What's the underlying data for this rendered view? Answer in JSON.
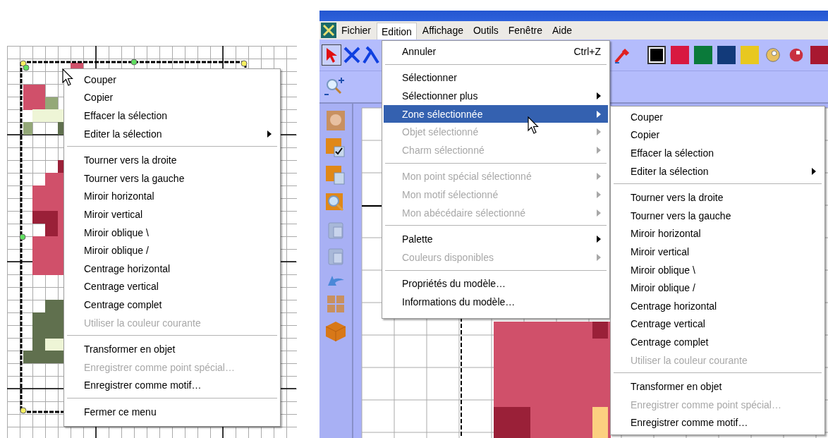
{
  "left_view": {
    "context_menu": {
      "groups": [
        [
          {
            "label": "Couper",
            "disabled": false,
            "submenu": false
          },
          {
            "label": "Copier",
            "disabled": false,
            "submenu": false
          },
          {
            "label": "Effacer la sélection",
            "disabled": false,
            "submenu": false
          },
          {
            "label": "Editer la sélection",
            "disabled": false,
            "submenu": true
          }
        ],
        [
          {
            "label": "Tourner vers la droite",
            "disabled": false,
            "submenu": false
          },
          {
            "label": "Tourner vers la gauche",
            "disabled": false,
            "submenu": false
          },
          {
            "label": "Miroir horizontal",
            "disabled": false,
            "submenu": false
          },
          {
            "label": "Miroir vertical",
            "disabled": false,
            "submenu": false
          },
          {
            "label": "Miroir oblique \\",
            "disabled": false,
            "submenu": false
          },
          {
            "label": "Miroir oblique /",
            "disabled": false,
            "submenu": false
          },
          {
            "label": "Centrage horizontal",
            "disabled": false,
            "submenu": false
          },
          {
            "label": "Centrage vertical",
            "disabled": false,
            "submenu": false
          },
          {
            "label": "Centrage complet",
            "disabled": false,
            "submenu": false
          },
          {
            "label": "Utiliser la couleur courante",
            "disabled": true,
            "submenu": false
          }
        ],
        [
          {
            "label": "Transformer en objet",
            "disabled": false,
            "submenu": false
          },
          {
            "label": "Enregistrer comme point spécial…",
            "disabled": true,
            "submenu": false
          },
          {
            "label": "Enregistrer comme motif…",
            "disabled": false,
            "submenu": false
          }
        ],
        [
          {
            "label": "Fermer ce menu",
            "disabled": false,
            "submenu": false
          }
        ]
      ]
    }
  },
  "right_view": {
    "menu_bar": [
      {
        "label": "Fichier",
        "selected": false
      },
      {
        "label": "Edition",
        "selected": true
      },
      {
        "label": "Affichage",
        "selected": false
      },
      {
        "label": "Outils",
        "selected": false
      },
      {
        "label": "Fenêtre",
        "selected": false
      },
      {
        "label": "Aide",
        "selected": false
      }
    ],
    "toolbar": {
      "swatches": [
        {
          "color": "#000000",
          "selected": true
        },
        {
          "color": "#d81840",
          "selected": false
        },
        {
          "color": "#0a7a3a",
          "selected": false
        },
        {
          "color": "#123a7a",
          "selected": false
        },
        {
          "color": "#e8c820",
          "selected": false
        },
        {
          "color": "#e8c060",
          "selected": false
        },
        {
          "color": "#c83040",
          "selected": false
        },
        {
          "color": "#a81830",
          "selected": false
        }
      ]
    },
    "edition_menu": {
      "groups": [
        [
          {
            "label": "Annuler",
            "shortcut": "Ctrl+Z",
            "disabled": false,
            "submenu": false,
            "selected": false
          }
        ],
        [
          {
            "label": "Sélectionner",
            "disabled": false,
            "submenu": false,
            "selected": false
          },
          {
            "label": "Sélectionner plus",
            "disabled": false,
            "submenu": true,
            "selected": false
          },
          {
            "label": "Zone sélectionnée",
            "disabled": false,
            "submenu": true,
            "selected": true
          },
          {
            "label": "Objet sélectionné",
            "disabled": true,
            "submenu": true,
            "selected": false
          },
          {
            "label": "Charm sélectionné",
            "disabled": true,
            "submenu": true,
            "selected": false
          }
        ],
        [
          {
            "label": "Mon point spécial sélectionné",
            "disabled": true,
            "submenu": true,
            "selected": false
          },
          {
            "label": "Mon motif sélectionné",
            "disabled": true,
            "submenu": true,
            "selected": false
          },
          {
            "label": "Mon abécédaire sélectionné",
            "disabled": true,
            "submenu": true,
            "selected": false
          }
        ],
        [
          {
            "label": "Palette",
            "disabled": false,
            "submenu": true,
            "selected": false
          },
          {
            "label": "Couleurs disponibles",
            "disabled": true,
            "submenu": true,
            "selected": false
          }
        ],
        [
          {
            "label": "Propriétés du modèle…",
            "disabled": false,
            "submenu": false,
            "selected": false
          },
          {
            "label": "Informations du modèle…",
            "disabled": false,
            "submenu": false,
            "selected": false
          }
        ]
      ]
    },
    "submenu": {
      "groups": [
        [
          {
            "label": "Couper",
            "disabled": false,
            "submenu": false
          },
          {
            "label": "Copier",
            "disabled": false,
            "submenu": false
          },
          {
            "label": "Effacer la sélection",
            "disabled": false,
            "submenu": false
          },
          {
            "label": "Editer la sélection",
            "disabled": false,
            "submenu": true
          }
        ],
        [
          {
            "label": "Tourner vers la droite",
            "disabled": false,
            "submenu": false
          },
          {
            "label": "Tourner vers la gauche",
            "disabled": false,
            "submenu": false
          },
          {
            "label": "Miroir horizontal",
            "disabled": false,
            "submenu": false
          },
          {
            "label": "Miroir vertical",
            "disabled": false,
            "submenu": false
          },
          {
            "label": "Miroir oblique \\",
            "disabled": false,
            "submenu": false
          },
          {
            "label": "Miroir oblique /",
            "disabled": false,
            "submenu": false
          },
          {
            "label": "Centrage horizontal",
            "disabled": false,
            "submenu": false
          },
          {
            "label": "Centrage vertical",
            "disabled": false,
            "submenu": false
          },
          {
            "label": "Centrage complet",
            "disabled": false,
            "submenu": false
          },
          {
            "label": "Utiliser la couleur courante",
            "disabled": true,
            "submenu": false
          }
        ],
        [
          {
            "label": "Transformer en objet",
            "disabled": false,
            "submenu": false
          },
          {
            "label": "Enregistrer comme point spécial…",
            "disabled": true,
            "submenu": false
          },
          {
            "label": "Enregistrer comme motif…",
            "disabled": false,
            "submenu": false
          }
        ]
      ]
    }
  }
}
